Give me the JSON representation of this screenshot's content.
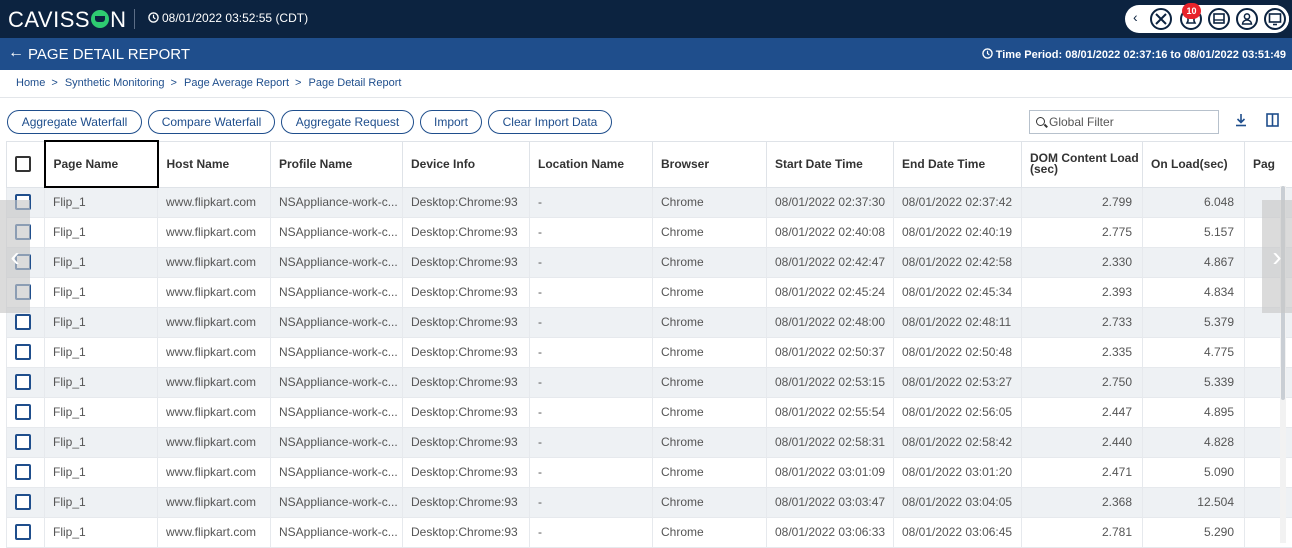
{
  "app": {
    "logo_text_left": "CAVISS",
    "logo_text_right": "N",
    "clock": "08/01/2022 03:52:55 (CDT)",
    "notification_count": "10"
  },
  "title_bar": {
    "back_glyph": "←",
    "title": "PAGE DETAIL REPORT",
    "time_period": "Time Period: 08/01/2022 02:37:16 to 08/01/2022 03:51:49"
  },
  "breadcrumb": [
    "Home",
    "Synthetic Monitoring",
    "Page Average Report",
    "Page Detail Report"
  ],
  "toolbar": {
    "buttons": [
      "Aggregate Waterfall",
      "Compare Waterfall",
      "Aggregate Request",
      "Import",
      "Clear Import Data"
    ],
    "filter_placeholder": "Global Filter"
  },
  "table": {
    "columns": [
      "Page Name",
      "Host Name",
      "Profile Name",
      "Device Info",
      "Location Name",
      "Browser",
      "Start Date Time",
      "End Date Time",
      "DOM Content Load (sec)",
      "On Load(sec)",
      "Pag"
    ],
    "rows": [
      [
        "Flip_1",
        "www.flipkart.com",
        "NSAppliance-work-c...",
        "Desktop:Chrome:93",
        "-",
        "Chrome",
        "08/01/2022 02:37:30",
        "08/01/2022 02:37:42",
        "2.799",
        "6.048"
      ],
      [
        "Flip_1",
        "www.flipkart.com",
        "NSAppliance-work-c...",
        "Desktop:Chrome:93",
        "-",
        "Chrome",
        "08/01/2022 02:40:08",
        "08/01/2022 02:40:19",
        "2.775",
        "5.157"
      ],
      [
        "Flip_1",
        "www.flipkart.com",
        "NSAppliance-work-c...",
        "Desktop:Chrome:93",
        "-",
        "Chrome",
        "08/01/2022 02:42:47",
        "08/01/2022 02:42:58",
        "2.330",
        "4.867"
      ],
      [
        "Flip_1",
        "www.flipkart.com",
        "NSAppliance-work-c...",
        "Desktop:Chrome:93",
        "-",
        "Chrome",
        "08/01/2022 02:45:24",
        "08/01/2022 02:45:34",
        "2.393",
        "4.834"
      ],
      [
        "Flip_1",
        "www.flipkart.com",
        "NSAppliance-work-c...",
        "Desktop:Chrome:93",
        "-",
        "Chrome",
        "08/01/2022 02:48:00",
        "08/01/2022 02:48:11",
        "2.733",
        "5.379"
      ],
      [
        "Flip_1",
        "www.flipkart.com",
        "NSAppliance-work-c...",
        "Desktop:Chrome:93",
        "-",
        "Chrome",
        "08/01/2022 02:50:37",
        "08/01/2022 02:50:48",
        "2.335",
        "4.775"
      ],
      [
        "Flip_1",
        "www.flipkart.com",
        "NSAppliance-work-c...",
        "Desktop:Chrome:93",
        "-",
        "Chrome",
        "08/01/2022 02:53:15",
        "08/01/2022 02:53:27",
        "2.750",
        "5.339"
      ],
      [
        "Flip_1",
        "www.flipkart.com",
        "NSAppliance-work-c...",
        "Desktop:Chrome:93",
        "-",
        "Chrome",
        "08/01/2022 02:55:54",
        "08/01/2022 02:56:05",
        "2.447",
        "4.895"
      ],
      [
        "Flip_1",
        "www.flipkart.com",
        "NSAppliance-work-c...",
        "Desktop:Chrome:93",
        "-",
        "Chrome",
        "08/01/2022 02:58:31",
        "08/01/2022 02:58:42",
        "2.440",
        "4.828"
      ],
      [
        "Flip_1",
        "www.flipkart.com",
        "NSAppliance-work-c...",
        "Desktop:Chrome:93",
        "-",
        "Chrome",
        "08/01/2022 03:01:09",
        "08/01/2022 03:01:20",
        "2.471",
        "5.090"
      ],
      [
        "Flip_1",
        "www.flipkart.com",
        "NSAppliance-work-c...",
        "Desktop:Chrome:93",
        "-",
        "Chrome",
        "08/01/2022 03:03:47",
        "08/01/2022 03:04:05",
        "2.368",
        "12.504"
      ],
      [
        "Flip_1",
        "www.flipkart.com",
        "NSAppliance-work-c...",
        "Desktop:Chrome:93",
        "-",
        "Chrome",
        "08/01/2022 03:06:33",
        "08/01/2022 03:06:45",
        "2.781",
        "5.290"
      ]
    ]
  },
  "icons": [
    "clock-icon",
    "back-arrow-icon",
    "breadcrumb-chevron-icon",
    "search-icon",
    "download-icon",
    "columns-icon",
    "tools-icon",
    "bell-icon",
    "display-icon",
    "user-icon",
    "monitor-icon",
    "chevron-left-icon",
    "chevron-right-icon"
  ],
  "colors": {
    "topbar": "#0c2340",
    "titlebar": "#1f4e8c",
    "accent": "#1f4e8c",
    "badge": "#e8232b",
    "row_alt": "#eef1f4"
  }
}
